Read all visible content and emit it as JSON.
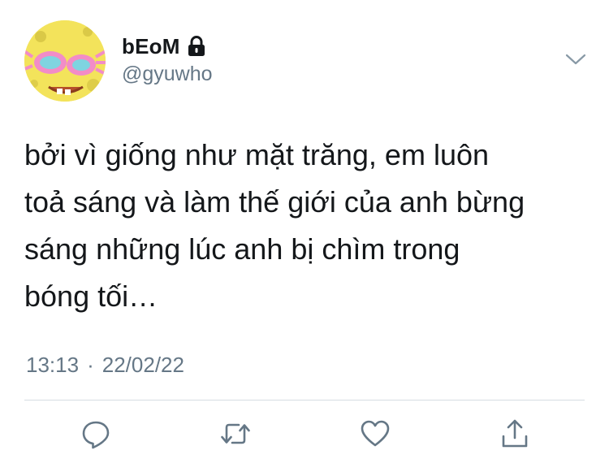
{
  "user": {
    "display_name": "bEoM",
    "handle": "@gyuwho",
    "avatar": "spongebob-sunglasses-avatar",
    "protected_icon": "lock-icon"
  },
  "tweet": {
    "text": "bởi vì giống như mặt trăng, em luôn\ntoả sáng và làm thế giới của anh bừng\nsáng những lúc anh bị chìm trong\nbóng tối…",
    "time": "13:13",
    "separator": "·",
    "date": "22/02/22"
  },
  "actions": [
    {
      "name": "reply",
      "icon": "reply-icon"
    },
    {
      "name": "retweet",
      "icon": "retweet-icon"
    },
    {
      "name": "like",
      "icon": "heart-icon"
    },
    {
      "name": "share",
      "icon": "share-icon"
    }
  ],
  "colors": {
    "text": "#14171a",
    "secondary": "#657786",
    "icon": "#657786",
    "divider": "#d6dde3"
  }
}
